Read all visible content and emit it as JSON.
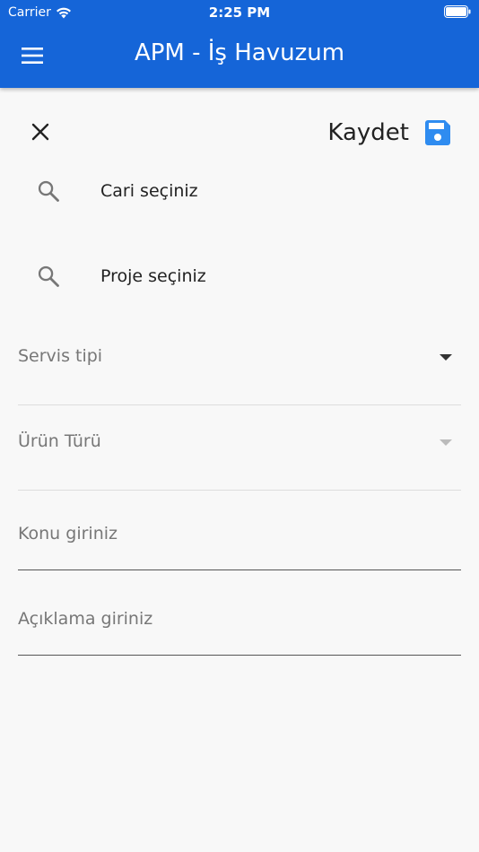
{
  "status_bar": {
    "carrier": "Carrier",
    "time": "2:25 PM"
  },
  "appbar": {
    "title": "APM - İş Havuzum",
    "menu_icon": "hamburger-menu-icon",
    "color": "#1565d8"
  },
  "toolbar": {
    "save_label": "Kaydet",
    "save_icon": "floppy-disk-icon",
    "close_icon": "close-icon",
    "save_icon_color": "#2f8cf0"
  },
  "form": {
    "cari_placeholder": "Cari seçiniz",
    "proje_placeholder": "Proje seçiniz",
    "servis_tipi_label": "Servis tipi",
    "urun_turu_label": "Ürün Türü",
    "konu_placeholder": "Konu giriniz",
    "aciklama_placeholder": "Açıklama giriniz"
  }
}
